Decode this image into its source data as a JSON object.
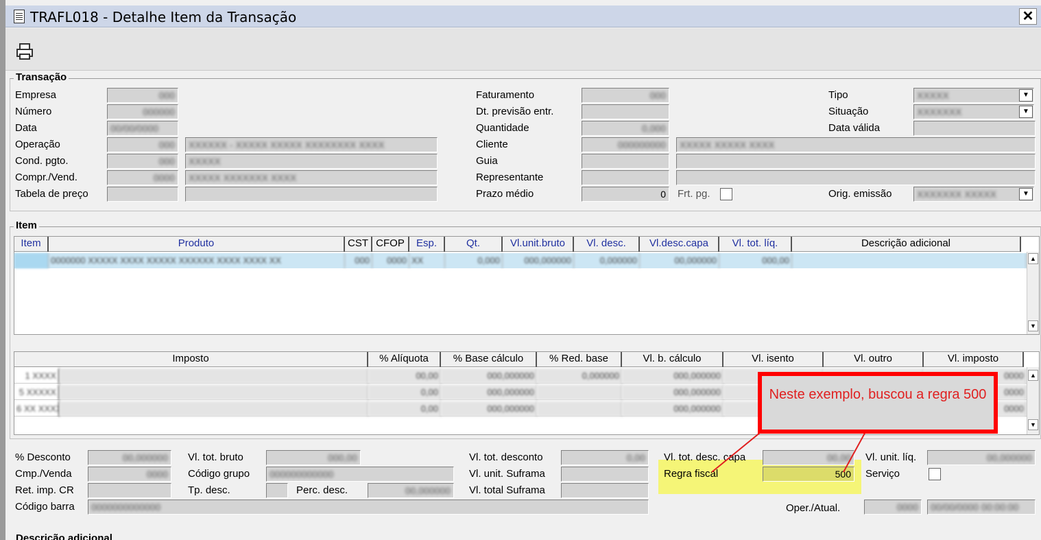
{
  "window": {
    "title": "TRAFL018 - Detalhe Item da Transação",
    "close_label": "✕"
  },
  "transacao": {
    "legend": "Transação",
    "labels": {
      "empresa": "Empresa",
      "numero": "Número",
      "data": "Data",
      "operacao": "Operação",
      "cond_pgto": "Cond. pgto.",
      "compr_vend": "Compr./Vend.",
      "tabela_preco": "Tabela de preço",
      "faturamento": "Faturamento",
      "dt_previsao": "Dt. previsão entr.",
      "quantidade": "Quantidade",
      "cliente": "Cliente",
      "guia": "Guia",
      "representante": "Representante",
      "prazo_medio": "Prazo médio",
      "frt_pg": "Frt. pg.",
      "tipo": "Tipo",
      "situacao": "Situação",
      "data_valida": "Data válida",
      "orig_emissao": "Orig. emissão"
    },
    "values": {
      "empresa": "000",
      "numero": "000000",
      "data": "00/00/0000",
      "operacao_cod": "000",
      "operacao_desc": "XXXXXX - XXXXX XXXXX XXXXXXXX XXXX",
      "cond_cod": "000",
      "cond_desc": "XXXXX",
      "compr_cod": "0000",
      "compr_desc": "XXXXX XXXXXXX XXXX",
      "faturamento": "000",
      "quantidade": "0,000",
      "cliente_cod": "000000000",
      "cliente_desc": "XXXXX XXXXX XXXX",
      "prazo_medio": "0",
      "tipo": "XXXXX",
      "situacao": "XXXXXXX",
      "orig_emissao": "XXXXXXX XXXXX"
    }
  },
  "item": {
    "legend": "Item",
    "columns": [
      "Item",
      "Produto",
      "CST",
      "CFOP",
      "Esp.",
      "Qt.",
      "Vl.unit.bruto",
      "Vl. desc.",
      "Vl.desc.capa",
      "Vl. tot. líq.",
      "Descrição adicional"
    ],
    "row": [
      "",
      "0000000 XXXXX XXXX XXXXX XXXXXX XXXX XXXX XX",
      "000",
      "0000",
      "XX",
      "0,000",
      "000,000000",
      "0,000000",
      "00,000000",
      "000,00",
      ""
    ]
  },
  "impostos": {
    "columns": [
      "Imposto",
      "% Alíquota",
      "% Base cálculo",
      "% Red. base",
      "Vl. b. cálculo",
      "Vl. isento",
      "Vl. outro",
      "Vl. imposto"
    ],
    "rows": [
      [
        "1 XXXX",
        "00,00",
        "000,000000",
        "0,000000",
        "000,000000",
        "",
        "",
        "0000"
      ],
      [
        "5 XXXXX",
        "0,00",
        "000,000000",
        "",
        "000,000000",
        "",
        "",
        "0000"
      ],
      [
        "6 XX XXXXX",
        "0,00",
        "000,000000",
        "",
        "000,000000",
        "",
        "",
        "0000"
      ]
    ]
  },
  "totais": {
    "labels": {
      "pct_desconto": "% Desconto",
      "cmp_venda": "Cmp./Venda",
      "ret_imp_cr": "Ret. imp. CR",
      "codigo_barra": "Código barra",
      "vl_tot_bruto": "Vl. tot. bruto",
      "codigo_grupo": "Código grupo",
      "tp_desc": "Tp. desc.",
      "perc_desc": "Perc. desc.",
      "vl_tot_desconto": "Vl. tot. desconto",
      "vl_unit_suframa": "Vl. unit. Suframa",
      "vl_total_suframa": "Vl. total Suframa",
      "vl_tot_desc_capa": "Vl. tot. desc. capa",
      "regra_fiscal": "Regra fiscal",
      "vl_unit_liq": "Vl. unit. líq.",
      "servico": "Serviço",
      "oper_atual": "Oper./Atual."
    },
    "values": {
      "pct_desconto": "00,000000",
      "cmp_venda": "0000",
      "vl_tot_bruto": "000,00",
      "codigo_grupo": "000000000000",
      "perc_desc": "00,000000",
      "vl_tot_desconto": "0,00",
      "vl_tot_desc_capa": "00,00",
      "regra_fiscal": "500",
      "vl_unit_liq": "00,000000",
      "codigo_barra": "0000000000000",
      "oper_cod": "0000",
      "oper_data": "00/00/0000 00:00:00"
    }
  },
  "descricao_adicional_legend": "Descrição adicional",
  "annotation": {
    "text": "Neste exemplo, buscou a regra 500"
  },
  "colors": {
    "highlight": "#f5f577",
    "callout_border": "#ff0000",
    "callout_text": "#e02020",
    "header_text": "#2030a0"
  }
}
